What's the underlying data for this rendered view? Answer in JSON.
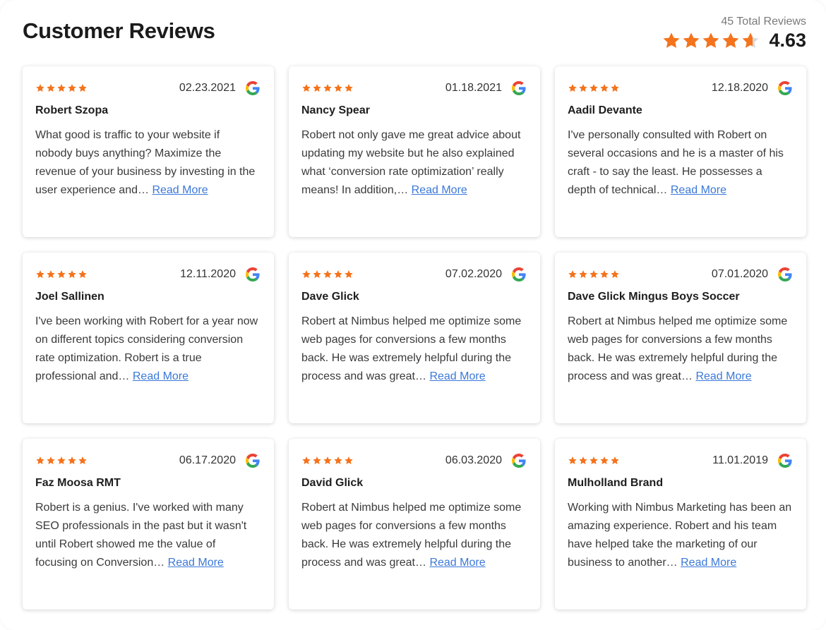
{
  "header": {
    "title": "Customer Reviews",
    "total_reviews": "45 Total Reviews",
    "average": "4.63",
    "average_rating_value": 4.63
  },
  "colors": {
    "star": "#f4731c",
    "link": "#3b78d8"
  },
  "read_more_label": "Read More",
  "reviews": [
    {
      "date": "02.23.2021",
      "name": "Robert Szopa",
      "text": "What good is traffic to your website if nobody buys anything? Maximize the revenue of your business by investing in the user experience and…",
      "stars": 5
    },
    {
      "date": "01.18.2021",
      "name": "Nancy Spear",
      "text": "Robert not only gave me great advice about updating my website but he also explained what ‘conversion rate optimization’ really means! In addition,…",
      "stars": 5
    },
    {
      "date": "12.18.2020",
      "name": "Aadil Devante",
      "text": "I've personally consulted with Robert on several occasions and he is a master of his craft - to say the least. He possesses a depth of technical…",
      "stars": 5
    },
    {
      "date": "12.11.2020",
      "name": "Joel Sallinen",
      "text": "I've been working with Robert for a year now on different topics considering conversion rate optimization. Robert is a true professional and…",
      "stars": 5
    },
    {
      "date": "07.02.2020",
      "name": "Dave Glick",
      "text": "Robert at Nimbus helped me optimize some web pages for conversions a few months back. He was extremely helpful during the process and was great…",
      "stars": 5
    },
    {
      "date": "07.01.2020",
      "name": "Dave Glick Mingus Boys Soccer",
      "text": "Robert at Nimbus helped me optimize some web pages for conversions a few months back. He was extremely helpful during the process and was great…",
      "stars": 5
    },
    {
      "date": "06.17.2020",
      "name": "Faz Moosa RMT",
      "text": "Robert is a genius. I've worked with many SEO professionals in the past but it wasn't until Robert showed me the value of focusing on Conversion…",
      "stars": 5
    },
    {
      "date": "06.03.2020",
      "name": "David Glick",
      "text": "Robert at Nimbus helped me optimize some web pages for conversions a few months back. He was extremely helpful during the process and was great…",
      "stars": 5
    },
    {
      "date": "11.01.2019",
      "name": "Mulholland Brand",
      "text": "Working with Nimbus Marketing has been an amazing experience. Robert and his team have helped take the marketing of our business to another…",
      "stars": 5
    }
  ]
}
